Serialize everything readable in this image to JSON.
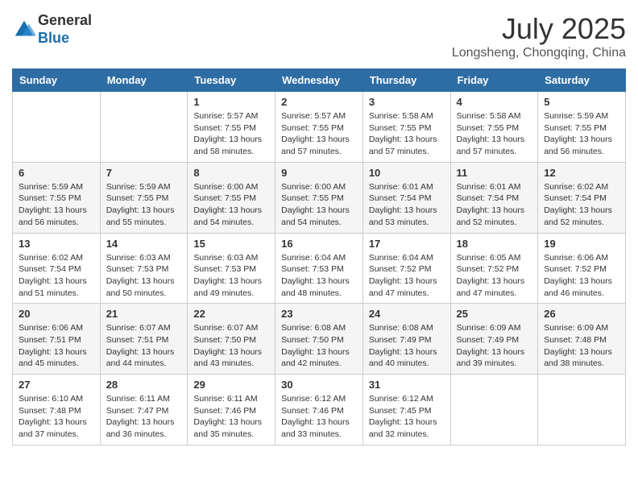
{
  "header": {
    "logo_line1": "General",
    "logo_line2": "Blue",
    "month_title": "July 2025",
    "location": "Longsheng, Chongqing, China"
  },
  "days_of_week": [
    "Sunday",
    "Monday",
    "Tuesday",
    "Wednesday",
    "Thursday",
    "Friday",
    "Saturday"
  ],
  "weeks": [
    [
      {
        "day": "",
        "info": ""
      },
      {
        "day": "",
        "info": ""
      },
      {
        "day": "1",
        "info": "Sunrise: 5:57 AM\nSunset: 7:55 PM\nDaylight: 13 hours and 58 minutes."
      },
      {
        "day": "2",
        "info": "Sunrise: 5:57 AM\nSunset: 7:55 PM\nDaylight: 13 hours and 57 minutes."
      },
      {
        "day": "3",
        "info": "Sunrise: 5:58 AM\nSunset: 7:55 PM\nDaylight: 13 hours and 57 minutes."
      },
      {
        "day": "4",
        "info": "Sunrise: 5:58 AM\nSunset: 7:55 PM\nDaylight: 13 hours and 57 minutes."
      },
      {
        "day": "5",
        "info": "Sunrise: 5:59 AM\nSunset: 7:55 PM\nDaylight: 13 hours and 56 minutes."
      }
    ],
    [
      {
        "day": "6",
        "info": "Sunrise: 5:59 AM\nSunset: 7:55 PM\nDaylight: 13 hours and 56 minutes."
      },
      {
        "day": "7",
        "info": "Sunrise: 5:59 AM\nSunset: 7:55 PM\nDaylight: 13 hours and 55 minutes."
      },
      {
        "day": "8",
        "info": "Sunrise: 6:00 AM\nSunset: 7:55 PM\nDaylight: 13 hours and 54 minutes."
      },
      {
        "day": "9",
        "info": "Sunrise: 6:00 AM\nSunset: 7:55 PM\nDaylight: 13 hours and 54 minutes."
      },
      {
        "day": "10",
        "info": "Sunrise: 6:01 AM\nSunset: 7:54 PM\nDaylight: 13 hours and 53 minutes."
      },
      {
        "day": "11",
        "info": "Sunrise: 6:01 AM\nSunset: 7:54 PM\nDaylight: 13 hours and 52 minutes."
      },
      {
        "day": "12",
        "info": "Sunrise: 6:02 AM\nSunset: 7:54 PM\nDaylight: 13 hours and 52 minutes."
      }
    ],
    [
      {
        "day": "13",
        "info": "Sunrise: 6:02 AM\nSunset: 7:54 PM\nDaylight: 13 hours and 51 minutes."
      },
      {
        "day": "14",
        "info": "Sunrise: 6:03 AM\nSunset: 7:53 PM\nDaylight: 13 hours and 50 minutes."
      },
      {
        "day": "15",
        "info": "Sunrise: 6:03 AM\nSunset: 7:53 PM\nDaylight: 13 hours and 49 minutes."
      },
      {
        "day": "16",
        "info": "Sunrise: 6:04 AM\nSunset: 7:53 PM\nDaylight: 13 hours and 48 minutes."
      },
      {
        "day": "17",
        "info": "Sunrise: 6:04 AM\nSunset: 7:52 PM\nDaylight: 13 hours and 47 minutes."
      },
      {
        "day": "18",
        "info": "Sunrise: 6:05 AM\nSunset: 7:52 PM\nDaylight: 13 hours and 47 minutes."
      },
      {
        "day": "19",
        "info": "Sunrise: 6:06 AM\nSunset: 7:52 PM\nDaylight: 13 hours and 46 minutes."
      }
    ],
    [
      {
        "day": "20",
        "info": "Sunrise: 6:06 AM\nSunset: 7:51 PM\nDaylight: 13 hours and 45 minutes."
      },
      {
        "day": "21",
        "info": "Sunrise: 6:07 AM\nSunset: 7:51 PM\nDaylight: 13 hours and 44 minutes."
      },
      {
        "day": "22",
        "info": "Sunrise: 6:07 AM\nSunset: 7:50 PM\nDaylight: 13 hours and 43 minutes."
      },
      {
        "day": "23",
        "info": "Sunrise: 6:08 AM\nSunset: 7:50 PM\nDaylight: 13 hours and 42 minutes."
      },
      {
        "day": "24",
        "info": "Sunrise: 6:08 AM\nSunset: 7:49 PM\nDaylight: 13 hours and 40 minutes."
      },
      {
        "day": "25",
        "info": "Sunrise: 6:09 AM\nSunset: 7:49 PM\nDaylight: 13 hours and 39 minutes."
      },
      {
        "day": "26",
        "info": "Sunrise: 6:09 AM\nSunset: 7:48 PM\nDaylight: 13 hours and 38 minutes."
      }
    ],
    [
      {
        "day": "27",
        "info": "Sunrise: 6:10 AM\nSunset: 7:48 PM\nDaylight: 13 hours and 37 minutes."
      },
      {
        "day": "28",
        "info": "Sunrise: 6:11 AM\nSunset: 7:47 PM\nDaylight: 13 hours and 36 minutes."
      },
      {
        "day": "29",
        "info": "Sunrise: 6:11 AM\nSunset: 7:46 PM\nDaylight: 13 hours and 35 minutes."
      },
      {
        "day": "30",
        "info": "Sunrise: 6:12 AM\nSunset: 7:46 PM\nDaylight: 13 hours and 33 minutes."
      },
      {
        "day": "31",
        "info": "Sunrise: 6:12 AM\nSunset: 7:45 PM\nDaylight: 13 hours and 32 minutes."
      },
      {
        "day": "",
        "info": ""
      },
      {
        "day": "",
        "info": ""
      }
    ]
  ]
}
